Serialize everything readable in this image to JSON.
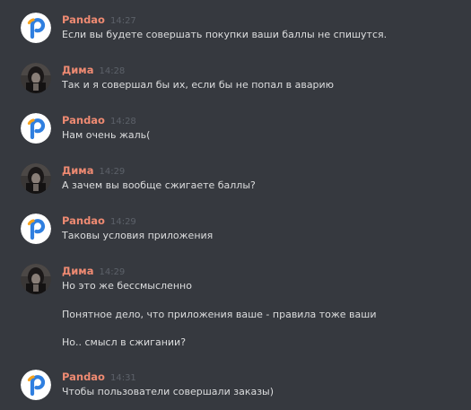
{
  "messages": [
    {
      "author": "Pandao",
      "time": "14:27",
      "avatar": "pandao-logo",
      "lines": [
        "Если вы будете совершать покупки ваши баллы не спишутся."
      ]
    },
    {
      "author": "Дима",
      "time": "14:28",
      "avatar": "user-photo",
      "lines": [
        "Так и я совершал бы их, если бы не попал в аварию"
      ]
    },
    {
      "author": "Pandao",
      "time": "14:28",
      "avatar": "pandao-logo",
      "lines": [
        "Нам очень жаль("
      ]
    },
    {
      "author": "Дима",
      "time": "14:29",
      "avatar": "user-photo",
      "lines": [
        "А зачем вы вообще сжигаете баллы?"
      ]
    },
    {
      "author": "Pandao",
      "time": "14:29",
      "avatar": "pandao-logo",
      "lines": [
        "Таковы условия приложения"
      ]
    },
    {
      "author": "Дима",
      "time": "14:29",
      "avatar": "user-photo",
      "lines": [
        "Но это же бессмысленно",
        "Понятное дело, что приложения ваше - правила тоже ваши",
        "Но.. смысл в сжигании?"
      ]
    },
    {
      "author": "Pandao",
      "time": "14:31",
      "avatar": "pandao-logo",
      "lines": [
        "Чтобы пользователи совершали заказы)"
      ]
    }
  ],
  "colors": {
    "background": "#36393f",
    "author": "#ee8a72",
    "timestamp": "#5c6169",
    "text": "#dcddde",
    "pandao_blue": "#2f7fe0",
    "pandao_orange": "#f7a21b"
  }
}
